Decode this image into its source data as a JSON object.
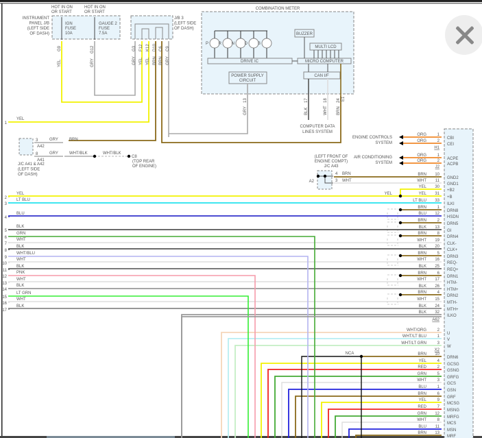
{
  "fuse_box": {
    "hot1": [
      "HOT IN ON",
      "OR START"
    ],
    "hot2": [
      "HOT IN ON",
      "OR START"
    ],
    "name": [
      "INSTRUMENT",
      "PANEL J/B",
      "(LEFT SIDE",
      "OF DASH)"
    ],
    "fuse1": [
      "IGN",
      "FUSE",
      "10A"
    ],
    "fuse2": [
      "GAUGE 2",
      "FUSE",
      "7.5A"
    ],
    "pins": [
      {
        "pin": "G9",
        "color": "YEL"
      },
      {
        "pin": "G12",
        "color": "GRY"
      }
    ]
  },
  "jb3": {
    "name": [
      "J/B 3",
      "(LEFT SIDE",
      "OF DASH)"
    ],
    "pins": [
      {
        "pin": "G3",
        "color": "GRY"
      },
      {
        "pin": "F12",
        "color": "YEL"
      },
      {
        "pin": "K12",
        "color": "YEL"
      },
      {
        "pin": "D10",
        "color": "BRN"
      },
      {
        "pin": "C6",
        "color": "BRN"
      },
      {
        "pin": "C9",
        "color": "GRY"
      }
    ]
  },
  "meter": {
    "title": "COMBINATION METER",
    "indicators": [
      "P",
      "R",
      "N",
      "D",
      "B"
    ],
    "drive_ic": "DRIVE IC",
    "buzzer": "BUZZER",
    "multi_lcd": "MULTI LCD",
    "micro": "MICRO COMPUTER",
    "power": [
      "POWER SUPPLY",
      "CIRCUIT"
    ],
    "can": "CAN I/F",
    "pins": [
      {
        "pin": "13",
        "color": "GRY"
      },
      {
        "pin": "17",
        "color": "BLK"
      },
      {
        "pin": "18",
        "color": "WHT"
      },
      {
        "pin": "24",
        "color": "BRN"
      }
    ],
    "e1": "E1",
    "data_lines": [
      "COMPUTER DATA",
      "LINES SYSTEM"
    ]
  },
  "jc_a41": {
    "pin_a42": "3",
    "conn_a42": "A42",
    "pin_a41": "8",
    "conn_a41": "A41",
    "gry1": "GRY",
    "gry2": "GRY",
    "brn": "BRN",
    "whtblk1": "WHT/BLK",
    "whtblk2": "WHT/BLK",
    "name": [
      "J/C A41 & A42",
      "(LEFT SIDE",
      "OF DASH)"
    ],
    "ground": "C8",
    "ground_loc": [
      "(TOP REAR",
      "OF ENGINE)"
    ]
  },
  "jc_a43": {
    "loc": [
      "(LEFT FRONT OF",
      "ENGINE COMPT)"
    ],
    "name": "J/C A43",
    "a2": "A2",
    "pin4": "4",
    "brn": "BRN",
    "pin3": "3",
    "wht": "WHT"
  },
  "engine_controls": [
    "ENGINE CONTROLS",
    "SYSTEM"
  ],
  "air_conditioning": [
    "AIR CONDITIONING",
    "SYSTEM"
  ],
  "yel_junction_label": "YEL",
  "nca_label": "NCA",
  "left_wires": [
    {
      "num": "1",
      "label": "YEL",
      "color": "#f2f200"
    },
    {
      "num": "2",
      "label": "YEL",
      "color": "#f2f200"
    },
    {
      "num": "3",
      "label": "LT BLU",
      "color": "#22e3ee"
    },
    {
      "num": "4",
      "label": "BLU",
      "color": "#3333cc"
    },
    {
      "num": "5",
      "label": "BLK",
      "color": "#555555"
    },
    {
      "num": "6",
      "label": "GRN",
      "color": "#44aa33"
    },
    {
      "num": "7",
      "label": "WHT",
      "color": "#dddddd"
    },
    {
      "num": "8",
      "label": "BLK",
      "color": "#555555"
    },
    {
      "num": "9",
      "label": "WHT/BLU",
      "color": "#b4b4f0"
    },
    {
      "num": "10",
      "label": "WHT",
      "color": "#dddddd"
    },
    {
      "num": "11",
      "label": "BLK",
      "color": "#666666"
    },
    {
      "num": "12",
      "label": "PNK",
      "color": "#f59aaa"
    },
    {
      "num": "13",
      "label": "WHT",
      "color": "#dddddd"
    },
    {
      "num": "14",
      "label": "BLK",
      "color": "#999999"
    },
    {
      "num": "15",
      "label": "LT GRN",
      "color": "#33ee33"
    },
    {
      "num": "16",
      "label": "WHT",
      "color": "#dddddd"
    },
    {
      "num": "17",
      "label": "BLK",
      "color": "#888888"
    }
  ],
  "connector_groups": [
    {
      "name": "H1",
      "pins": [
        {
          "signal": "CBI",
          "wire": "ORG",
          "pin": "1",
          "color": "#f0882a"
        },
        {
          "signal": "CEI",
          "wire": "ORG",
          "pin": "2",
          "color": "#f0882a"
        }
      ]
    },
    {
      "name": "J2",
      "pins": [
        {
          "signal": "ACPE",
          "wire": "ORG",
          "pin": "1",
          "color": "#f0882a"
        },
        {
          "signal": "ACPB",
          "wire": "ORG",
          "pin": "2",
          "color": "#f0882a"
        }
      ]
    },
    {
      "name": "A62",
      "pins": [
        {
          "signal": "GND2",
          "wire": "BRN",
          "pin": "10",
          "color": "#8a6a1a"
        },
        {
          "signal": "GND1",
          "wire": "WHT",
          "pin": "11",
          "color": "#dddddd"
        },
        {
          "signal": "+B2",
          "wire": "YEL",
          "pin": "30",
          "color": "#f2f200"
        },
        {
          "signal": "+B",
          "wire": "YEL",
          "pin": "31",
          "color": "#f2f200"
        },
        {
          "signal": "ILKI",
          "wire": "LT BLU",
          "pin": "33",
          "color": "#22e3ee"
        },
        {
          "signal": "DRN8",
          "wire": "BRN",
          "pin": "1",
          "color": "#8a6a1a"
        },
        {
          "signal": "HSDN",
          "wire": "BLU",
          "pin": "12",
          "color": "#3333cc"
        },
        {
          "signal": "DRN5",
          "wire": "BRN",
          "pin": "2",
          "color": "#8a6a1a"
        },
        {
          "signal": "GI",
          "wire": "BLK",
          "pin": "13",
          "color": "#555555"
        },
        {
          "signal": "DRN4",
          "wire": "BRN",
          "pin": "8",
          "color": "#8a6a1a"
        },
        {
          "signal": "CLK-",
          "wire": "WHT",
          "pin": "19",
          "color": "#dddddd"
        },
        {
          "signal": "CLK+",
          "wire": "BLK",
          "pin": "20",
          "color": "#555555"
        },
        {
          "signal": "DRN3",
          "wire": "BRN",
          "pin": "5",
          "color": "#8a6a1a"
        },
        {
          "signal": "REQ-",
          "wire": "WHT",
          "pin": "16",
          "color": "#dddddd"
        },
        {
          "signal": "REQ+",
          "wire": "BLK",
          "pin": "25",
          "color": "#666666"
        },
        {
          "signal": "DRN1",
          "wire": "BRN",
          "pin": "6",
          "color": "#8a6a1a"
        },
        {
          "signal": "HTM-",
          "wire": "WHT",
          "pin": "17",
          "color": "#dddddd"
        },
        {
          "signal": "HTM+",
          "wire": "BLK",
          "pin": "26",
          "color": "#999999"
        },
        {
          "signal": "DRN2",
          "wire": "BRN",
          "pin": "4",
          "color": "#8a6a1a"
        },
        {
          "signal": "MTH-",
          "wire": "WHT",
          "pin": "15",
          "color": "#dddddd"
        },
        {
          "signal": "MTH+",
          "wire": "BLK",
          "pin": "24",
          "color": "#888888"
        },
        {
          "signal": "ILKO",
          "wire": "BLK",
          "pin": "32",
          "color": "#999999"
        }
      ]
    },
    {
      "name": "X2",
      "pins": [
        {
          "signal": "U",
          "wire": "WHT/ORG",
          "pin": "2",
          "color": "#f5d6ba"
        },
        {
          "signal": "V",
          "wire": "WHT/LT BLU",
          "pin": "1",
          "color": "#b8eef2"
        },
        {
          "signal": "W",
          "wire": "WHT/LT GRN",
          "pin": "3",
          "color": "#c4eec4"
        }
      ]
    },
    {
      "name": "",
      "pins": [
        {
          "signal": "DRN6",
          "wire": "BRN",
          "pin": "10",
          "color": "#8a6a1a"
        },
        {
          "signal": "GCSG",
          "wire": "YEL",
          "pin": "4",
          "color": "#f2f200"
        },
        {
          "signal": "GSNG",
          "wire": "RED",
          "pin": "2",
          "color": "#ee2222"
        },
        {
          "signal": "GRFG",
          "wire": "GRN",
          "pin": "5",
          "color": "#44aa33"
        },
        {
          "signal": "GCS",
          "wire": "WHT",
          "pin": "3",
          "color": "#dddddd"
        },
        {
          "signal": "GSN",
          "wire": "BLU",
          "pin": "1",
          "color": "#2222dd"
        },
        {
          "signal": "GRF",
          "wire": "BRN",
          "pin": "6",
          "color": "#8a6a1a"
        },
        {
          "signal": "MCSG",
          "wire": "YEL",
          "pin": "9",
          "color": "#f2f200"
        },
        {
          "signal": "MSNG",
          "wire": "RED",
          "pin": "7",
          "color": "#ee2222"
        },
        {
          "signal": "MRFG",
          "wire": "GRN",
          "pin": "12",
          "color": "#44aa33"
        },
        {
          "signal": "MCS",
          "wire": "WHT",
          "pin": "8",
          "color": "#dddddd"
        },
        {
          "signal": "MSN",
          "wire": "BLU",
          "pin": "11",
          "color": "#2222dd"
        },
        {
          "signal": "MRF",
          "wire": "BRN",
          "pin": "13",
          "color": "#8a6a1a"
        }
      ]
    }
  ]
}
